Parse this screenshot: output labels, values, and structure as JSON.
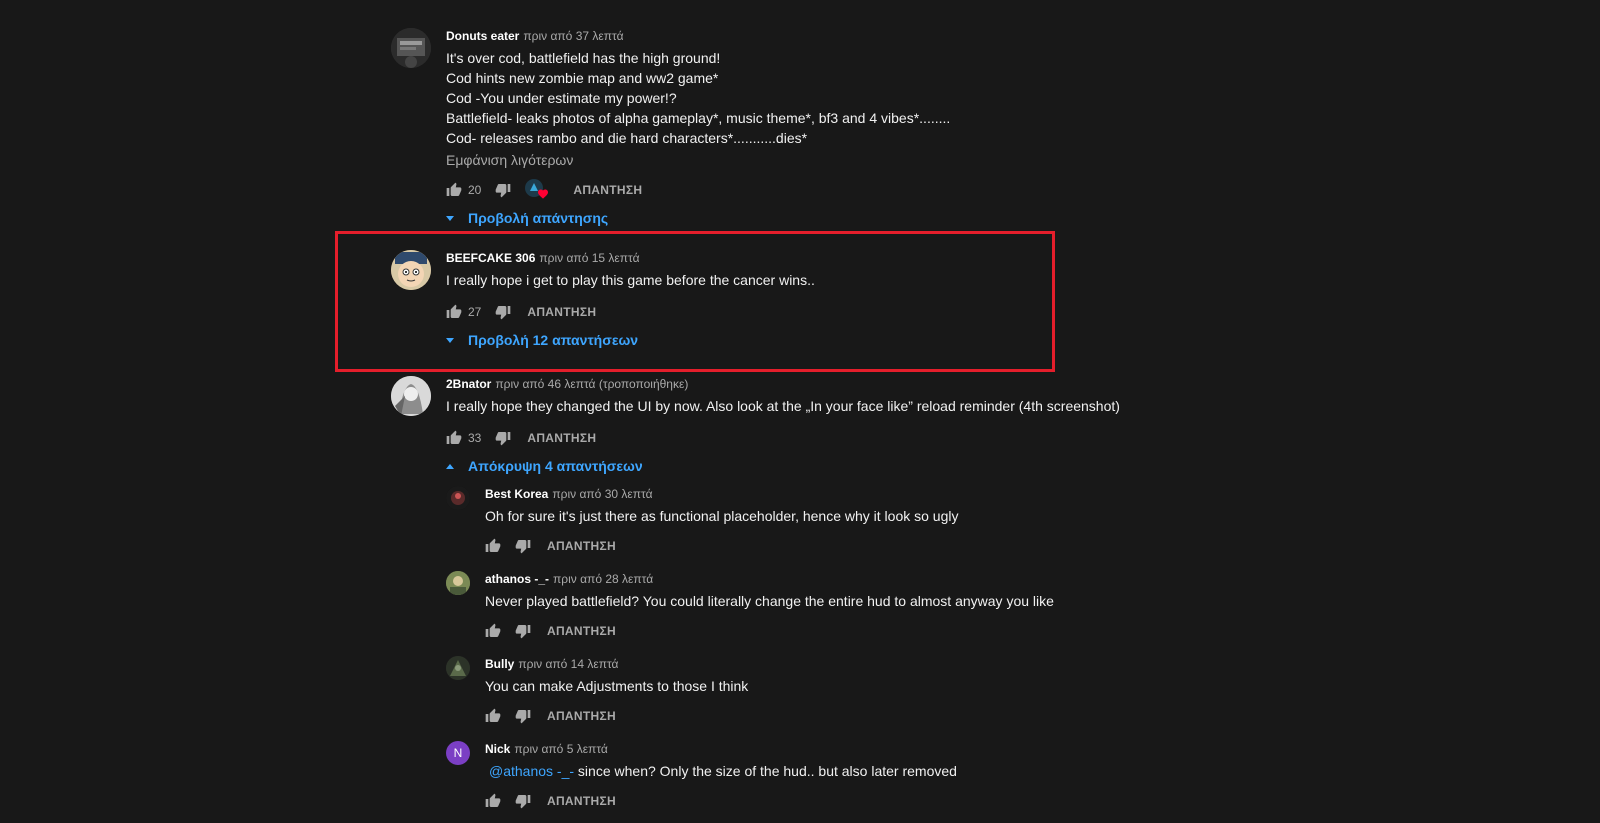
{
  "colors": {
    "background": "#181818",
    "link": "#3ea6ff",
    "highlight": "#e41e2b",
    "muted": "#aaaaaa"
  },
  "comments": [
    {
      "author": "Donuts eater",
      "time": "πριν από 37 λεπτά",
      "lines": [
        "It's over cod, battlefield has the high ground!",
        "Cod hints new zombie map and ww2 game*",
        "Cod -You under estimate my power!?",
        "Battlefield- leaks photos of alpha gameplay*, music theme*, bf3 and 4 vibes*........",
        "Cod- releases rambo and die hard characters*...........dies*"
      ],
      "show_less": "Εμφάνιση λιγότερων",
      "likes": "20",
      "reply_label": "ΑΠΑΝΤΗΣΗ",
      "view_replies": "Προβολή απάντησης"
    },
    {
      "author": "BEEFCAKE 306",
      "time": "πριν από 15 λεπτά",
      "text": "I really hope i get to play this game before the cancer wins..",
      "likes": "27",
      "reply_label": "ΑΠΑΝΤΗΣΗ",
      "view_replies": "Προβολή 12 απαντήσεων"
    },
    {
      "author": "2Bnator",
      "time": "πριν από 46 λεπτά (τροποποιήθηκε)",
      "text": "I really hope they changed the UI by now. Also look at the „In your face like” reload reminder (4th screenshot)",
      "likes": "33",
      "reply_label": "ΑΠΑΝΤΗΣΗ",
      "hide_replies": "Απόκρυψη 4 απαντήσεων"
    }
  ],
  "replies": [
    {
      "author": "Best Korea",
      "time": "πριν από 30 λεπτά",
      "text": "Oh for sure it's just there as functional placeholder, hence why it look so ugly",
      "reply_label": "ΑΠΑΝΤΗΣΗ"
    },
    {
      "author": "athanos -_-",
      "time": "πριν από 28 λεπτά",
      "text": "Never played battlefield? You could literally change the entire hud to almost anyway you like",
      "reply_label": "ΑΠΑΝΤΗΣΗ"
    },
    {
      "author": "Bully",
      "time": "πριν από 14 λεπτά",
      "text": "You can make Adjustments to those I think",
      "reply_label": "ΑΠΑΝΤΗΣΗ"
    },
    {
      "author": "Nick",
      "time": "πριν από 5 λεπτά",
      "mention": "@athanos -_-",
      "text": " since when? Only the size of the hud.. but also later removed",
      "avatar_letter": "N",
      "reply_label": "ΑΠΑΝΤΗΣΗ"
    }
  ]
}
